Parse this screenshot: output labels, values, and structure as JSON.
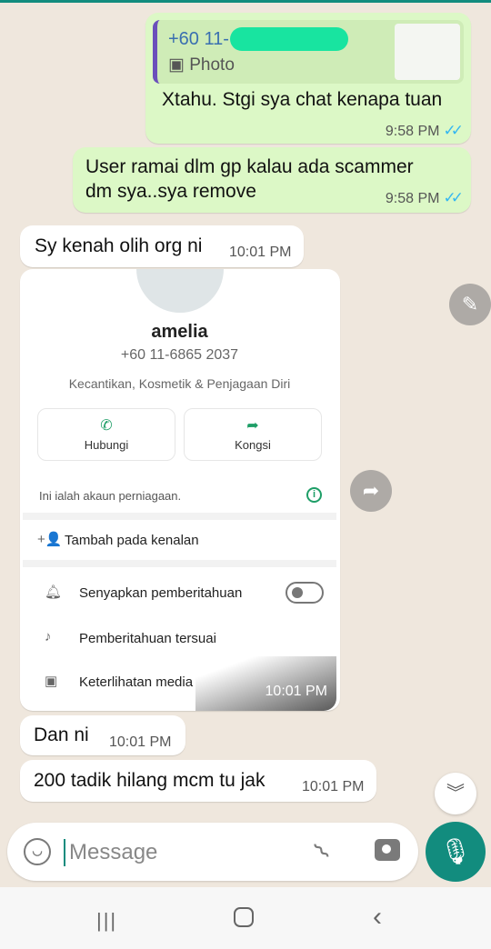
{
  "chat": {
    "messages": [
      {
        "direction": "out",
        "reply_to": {
          "name": "+60 11-",
          "type_label": "Photo"
        },
        "text": "Xtahu. Stgi sya chat kenapa tuan",
        "time": "9:58 PM",
        "status": "read"
      },
      {
        "direction": "out",
        "text_lines": [
          "User ramai dlm gp kalau ada scammer",
          "dm sya..sya remove"
        ],
        "time": "9:58 PM",
        "status": "read"
      },
      {
        "direction": "in",
        "text": "Sy kenah olih org ni",
        "time": "10:01 PM"
      },
      {
        "direction": "in",
        "type": "image",
        "time": "10:01 PM",
        "profile": {
          "name": "amelia",
          "phone": "+60 11-6865 2037",
          "category": "Kecantikan, Kosmetik & Penjagaan Diri",
          "actions": [
            {
              "label": "Hubungi",
              "icon": "phone-icon"
            },
            {
              "label": "Kongsi",
              "icon": "share-icon"
            }
          ],
          "business_notice": "Ini ialah akaun perniagaan.",
          "add_contact": "Tambah pada kenalan",
          "rows": [
            {
              "label": "Senyapkan pemberitahuan",
              "icon": "bell-icon",
              "toggle": false
            },
            {
              "label": "Pemberitahuan tersuai",
              "icon": "music-note-icon"
            },
            {
              "label": "Keterlihatan media",
              "icon": "image-icon"
            }
          ]
        }
      },
      {
        "direction": "in",
        "text": "Dan ni",
        "time": "10:01 PM"
      },
      {
        "direction": "in",
        "text": "200 tadik hilang mcm tu jak",
        "time": "10:01 PM"
      }
    ]
  },
  "composer": {
    "placeholder": "Message"
  },
  "colors": {
    "outgoing_bubble": "#dcf8c6",
    "incoming_bubble": "#ffffff",
    "read_ticks": "#34b7f1",
    "accent": "#128c7e",
    "wallpaper": "#efe7dd"
  },
  "icons": [
    "edit-icon",
    "forward-icon",
    "chevron-down-icon",
    "emoji-icon",
    "attach-icon",
    "camera-icon",
    "mic-icon"
  ]
}
